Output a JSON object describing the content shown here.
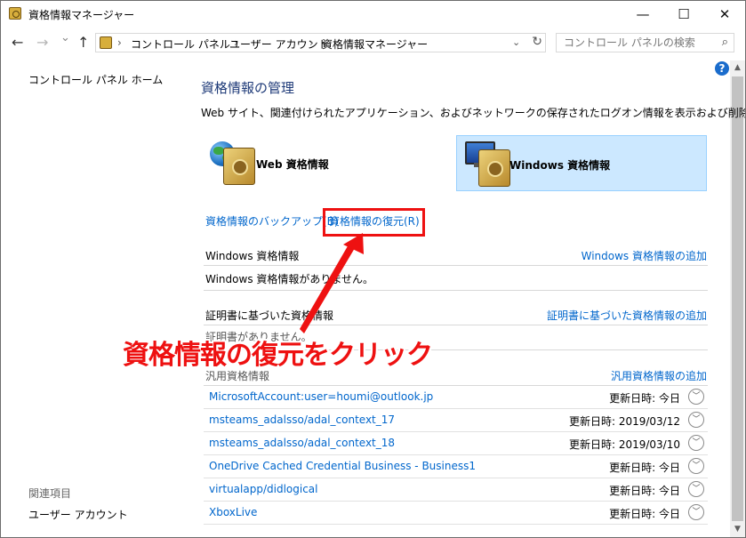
{
  "window": {
    "title": "資格情報マネージャー",
    "minimize": "—",
    "maximize": "☐",
    "close": "✕"
  },
  "nav": {
    "back": "←",
    "forward": "→",
    "history": "⌄",
    "up": "↑"
  },
  "breadcrumb": [
    "コントロール パネル",
    "ユーザー アカウント",
    "資格情報マネージャー"
  ],
  "search": {
    "placeholder": "コントロール パネルの検索"
  },
  "help": "?",
  "sidebar": {
    "home": "コントロール パネル ホーム",
    "related_heading": "関連項目",
    "related_link": "ユーザー アカウント"
  },
  "main": {
    "title": "資格情報の管理",
    "description": "Web サイト、関連付けられたアプリケーション、およびネットワークの保存されたログオン情報を表示および削除します。",
    "tiles": [
      {
        "label": "Web 資格情報",
        "selected": false
      },
      {
        "label": "Windows 資格情報",
        "selected": true
      }
    ],
    "backup_link": "資格情報のバックアップ(B)",
    "restore_link": "資格情報の復元(R)",
    "windows_section": {
      "title": "Windows 資格情報",
      "add": "Windows 資格情報の追加",
      "empty": "Windows 資格情報がありません。"
    },
    "cert_section": {
      "title": "証明書に基づいた資格情報",
      "add": "証明書に基づいた資格情報の追加",
      "empty": "証明書がありません。"
    },
    "generic_section": {
      "title": "汎用資格情報",
      "add": "汎用資格情報の追加",
      "modified_label": "更新日時:",
      "items": [
        {
          "name": "MicrosoftAccount:user=houmi@outlook.jp",
          "date": "今日"
        },
        {
          "name": "msteams_adalsso/adal_context_17",
          "date": "2019/03/12"
        },
        {
          "name": "msteams_adalsso/adal_context_18",
          "date": "2019/03/10"
        },
        {
          "name": "OneDrive Cached Credential Business - Business1",
          "date": "今日"
        },
        {
          "name": "virtualapp/didlogical",
          "date": "今日"
        },
        {
          "name": "XboxLive",
          "date": "今日"
        }
      ]
    }
  },
  "annotation": {
    "text": "資格情報の復元をクリック",
    "color": "#ee1111"
  },
  "colors": {
    "link": "#0066cc",
    "title": "#1e3a78",
    "selected_tile": "#cce8ff"
  }
}
